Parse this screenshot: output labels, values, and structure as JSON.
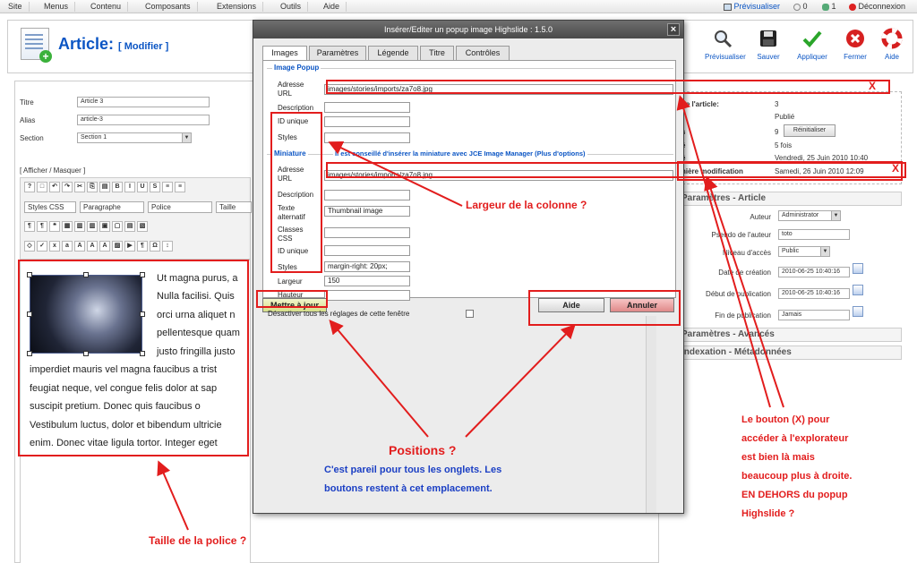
{
  "menubar": {
    "items": [
      "Site",
      "Menus",
      "Contenu",
      "Composants",
      "Extensions",
      "Outils",
      "Aide"
    ],
    "preview_label": "Prévisualiser",
    "count_a": "0",
    "count_b": "1",
    "logout_label": "Déconnexion"
  },
  "header": {
    "title": "Article:",
    "subtitle": "[ Modifier ]",
    "buttons": {
      "preview": "Prévisualiser",
      "save": "Sauver",
      "apply": "Appliquer",
      "close": "Fermer",
      "help": "Aide"
    }
  },
  "form": {
    "title_label": "Titre",
    "title_value": "Article 3",
    "alias_label": "Alias",
    "alias_value": "article-3",
    "section_label": "Section",
    "section_value": "Section 1",
    "toggle_label": "[ Afficher / Masquer ]"
  },
  "editor": {
    "styles_select": "Styles CSS",
    "paragraph_select": "Paragraphe",
    "font_select": "Police",
    "size_select": "Taille",
    "lines": [
      "Ut magna purus, a",
      "Nulla facilisi. Quis",
      "orci urna aliquet n",
      "pellentesque quam",
      "justo fringilla justo",
      "imperdiet mauris vel magna faucibus a trist",
      "feugiat neque, vel congue felis dolor at sap",
      "suscipit pretium. Donec quis faucibus o",
      "Vestibulum luctus, dolor et bibendum ultricie",
      "enim. Donec vitae ligula tortor. Integer eget"
    ]
  },
  "info": {
    "id_label": "de l'article:",
    "id_value": "3",
    "status_value": "Publié",
    "hits_label": "s",
    "hits_value": "9",
    "reset_label": "Réinitialiser",
    "revised_label": "é",
    "revised_value": "5 fois",
    "created_label": "é",
    "created_value": "Vendredi, 25 Juin 2010 10:40",
    "modified_label": "nière modification",
    "modified_value": "Samedi, 26 Juin 2010 12:09"
  },
  "params": {
    "header": "Paramètres - Article",
    "author_label": "Auteur",
    "author_value": "Administrator",
    "alias_label": "Pseudo de l'auteur",
    "alias_value": "toto",
    "access_label": "Niveau d'accès",
    "access_value": "Public",
    "created_label": "Date de création",
    "created_value": "2010-06-25 10:40:16",
    "start_label": "Début de publication",
    "start_value": "2010-06-25 10:40:16",
    "end_label": "Fin de publication",
    "end_value": "Jamais",
    "advanced_header": "Paramètres - Avancés",
    "meta_header": "Indexation - Métadonnées"
  },
  "popup": {
    "title": "Insérer/Editer un popup image Highslide : 1.5.0",
    "tabs": [
      "Images",
      "Paramètres",
      "Légende",
      "Titre",
      "Contrôles"
    ],
    "legend_popup": "Image Popup",
    "url_label": "Adresse URL",
    "url_value": "images/stories/imports/za7o8.jpg",
    "desc_label": "Description",
    "id_label": "ID unique",
    "styles_label": "Styles",
    "legend_thumb": "Miniature",
    "thumb_note": "Il est conseillé d'insérer la miniature avec JCE Image Manager (Plus d'options)",
    "thumb_url_label": "Adresse URL",
    "thumb_url_value": "images/stories/imports/za7o8.jpg",
    "thumb_desc_label": "Description",
    "alt_label": "Texte alternatif",
    "alt_value": "Thumbnail image",
    "class_label": "Classes CSS",
    "thumb_id_label": "ID unique",
    "thumb_styles_label": "Styles",
    "thumb_styles_value": "margin-right: 20px;",
    "width_label": "Largeur",
    "width_value": "150",
    "height_label": "Hauteur",
    "update_button": "Mettre à jour",
    "disable_label": "Désactiver tous les réglages de cette fenêtre",
    "help_button": "Aide",
    "cancel_button": "Annuler"
  },
  "annotations": {
    "x_top": "X",
    "x_bottom": "X",
    "column_width": "Largeur de la colonne ?",
    "positions": "Positions ?",
    "positions_note_1": "C'est pareil pour tous les onglets. Les",
    "positions_note_2": "boutons restent à cet emplacement.",
    "font_size": "Taille de la police ?",
    "x_note": [
      "Le bouton (X) pour",
      "accéder à l'explorateur",
      "est bien là mais",
      "beaucoup plus à droite.",
      "EN DEHORS du popup",
      "Highslide ?"
    ]
  },
  "colors": {
    "accent": "#0b55c4",
    "annotation_red": "#e21d1d",
    "annotation_blue": "#1b3fc4"
  }
}
